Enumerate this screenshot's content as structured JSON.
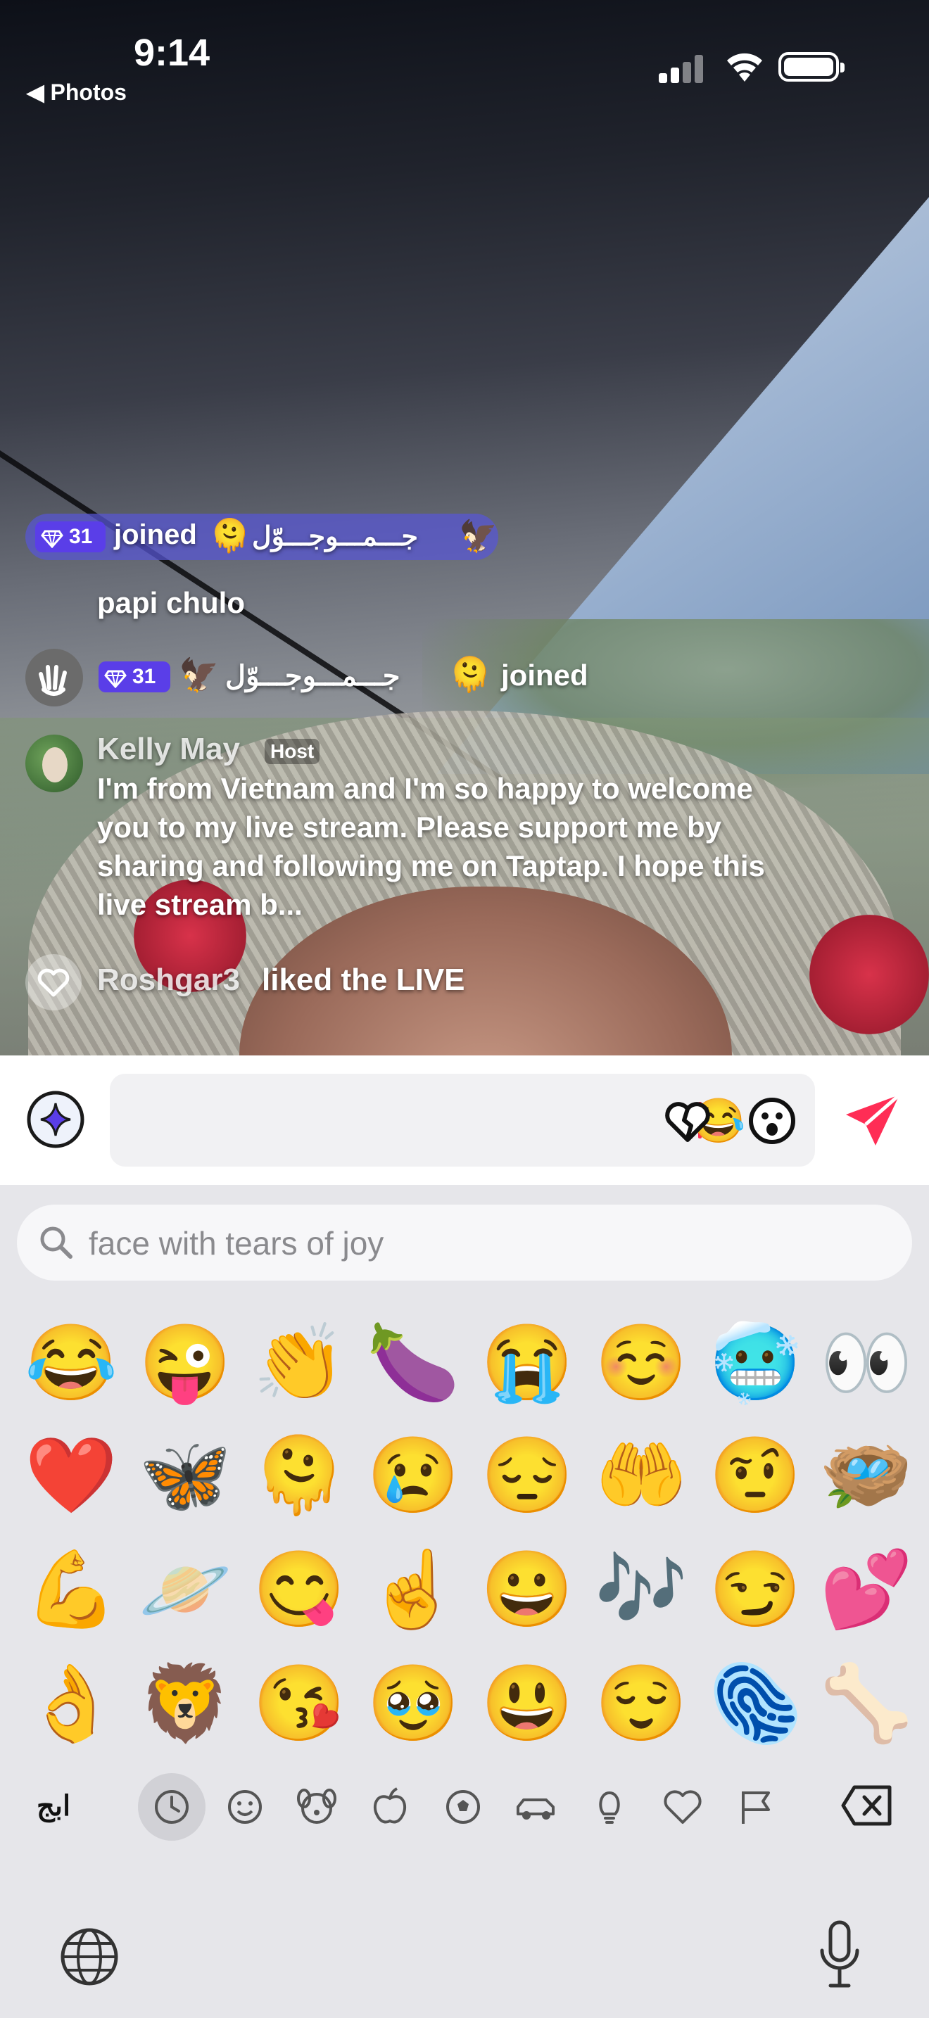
{
  "status_bar": {
    "time": "9:14",
    "back_app": "◀ Photos"
  },
  "chat": {
    "banner_badge": "31",
    "banner_joined": "joined",
    "banner_username": "جـــمـــوجـــوّل",
    "message_papi": "papi chulo",
    "row2_badge": "31",
    "row2_username": "جـــمـــوجـــوّل",
    "row2_joined": "joined",
    "host_name": "Kelly May",
    "host_tag": "Host",
    "host_message_lines": [
      "I'm from Vietnam and I'm so happy to welcome",
      "you to my live stream. Please support me by",
      "sharing and following me on Taptap. I hope this",
      "live stream b..."
    ],
    "like_user": "Roshgar3",
    "like_text": "liked the LIVE"
  },
  "input_bar": {
    "quick_emojis": [
      "😂",
      "🖤",
      "😮"
    ]
  },
  "keyboard": {
    "search_placeholder": "face with tears of joy",
    "emoji_rows": [
      [
        "😂",
        "😜",
        "👏",
        "🍆",
        "😭",
        "☺️",
        "🥶",
        "👀"
      ],
      [
        "❤️",
        "🦋",
        "🫠",
        "😢",
        "😔",
        "🤲",
        "🤨",
        "🪺"
      ],
      [
        "💪",
        "🪐",
        "😋",
        "☝️",
        "😀",
        "🎶",
        "😏",
        "💕"
      ],
      [
        "👌",
        "🦁",
        "😘",
        "🥹",
        "😃",
        "😌",
        "🫆",
        "🦴"
      ]
    ],
    "alphabet_key": "ابج",
    "categories": [
      "recent-icon",
      "smiley-icon",
      "animal-icon",
      "food-icon",
      "ball-icon",
      "car-icon",
      "lightbulb-icon",
      "heart-icon",
      "flag-icon"
    ]
  },
  "colors": {
    "accent": "#ff2d55",
    "badge": "#5a3ee8",
    "banner": "#5856d6"
  }
}
